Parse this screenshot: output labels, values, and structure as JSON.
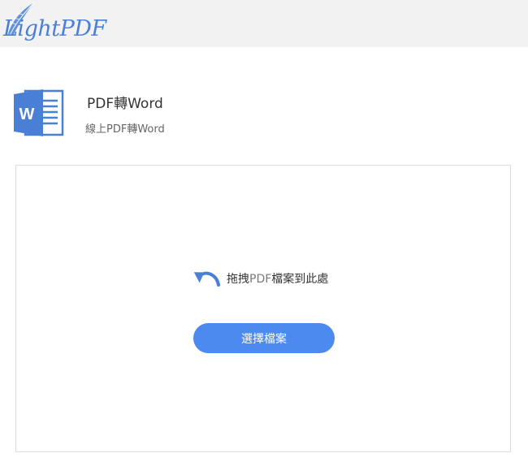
{
  "brand": {
    "logo_text": "LightPDF"
  },
  "tool": {
    "icon": "word-document-icon",
    "title": "PDF轉Word",
    "subtitle": "線上PDF轉Word"
  },
  "upload": {
    "drag_prefix": "拖拽",
    "drag_highlight": "PDF",
    "drag_suffix": "檔案到此處",
    "select_button_label": "選擇檔案"
  },
  "colors": {
    "accent": "#4d8af0",
    "logo": "#4a7fd6",
    "word_icon": "#4a7fd6",
    "header_bg": "#f2f2f2"
  }
}
